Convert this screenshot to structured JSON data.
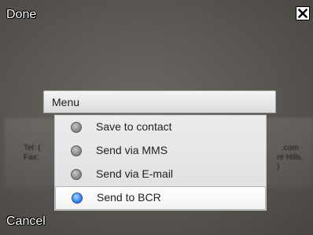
{
  "top_bar": {
    "done_label": "Done",
    "close_icon": "close-x-icon"
  },
  "bottom_bar": {
    "cancel_label": "Cancel"
  },
  "background_card": {
    "left_line_1": "Tel: (",
    "left_line_2": "Fax:",
    "right_line_1": ".com",
    "right_line_2": "re Hills,",
    "right_line_3": ")"
  },
  "menu": {
    "title": "Menu",
    "items": [
      {
        "label": "Save to contact",
        "selected": false
      },
      {
        "label": "Send via MMS",
        "selected": false
      },
      {
        "label": "Send via E-mail",
        "selected": false
      },
      {
        "label": "Send to BCR",
        "selected": true
      }
    ],
    "colors": {
      "selected_radio": "#3d8cf0",
      "unselected_radio": "#8a8a8a"
    }
  }
}
